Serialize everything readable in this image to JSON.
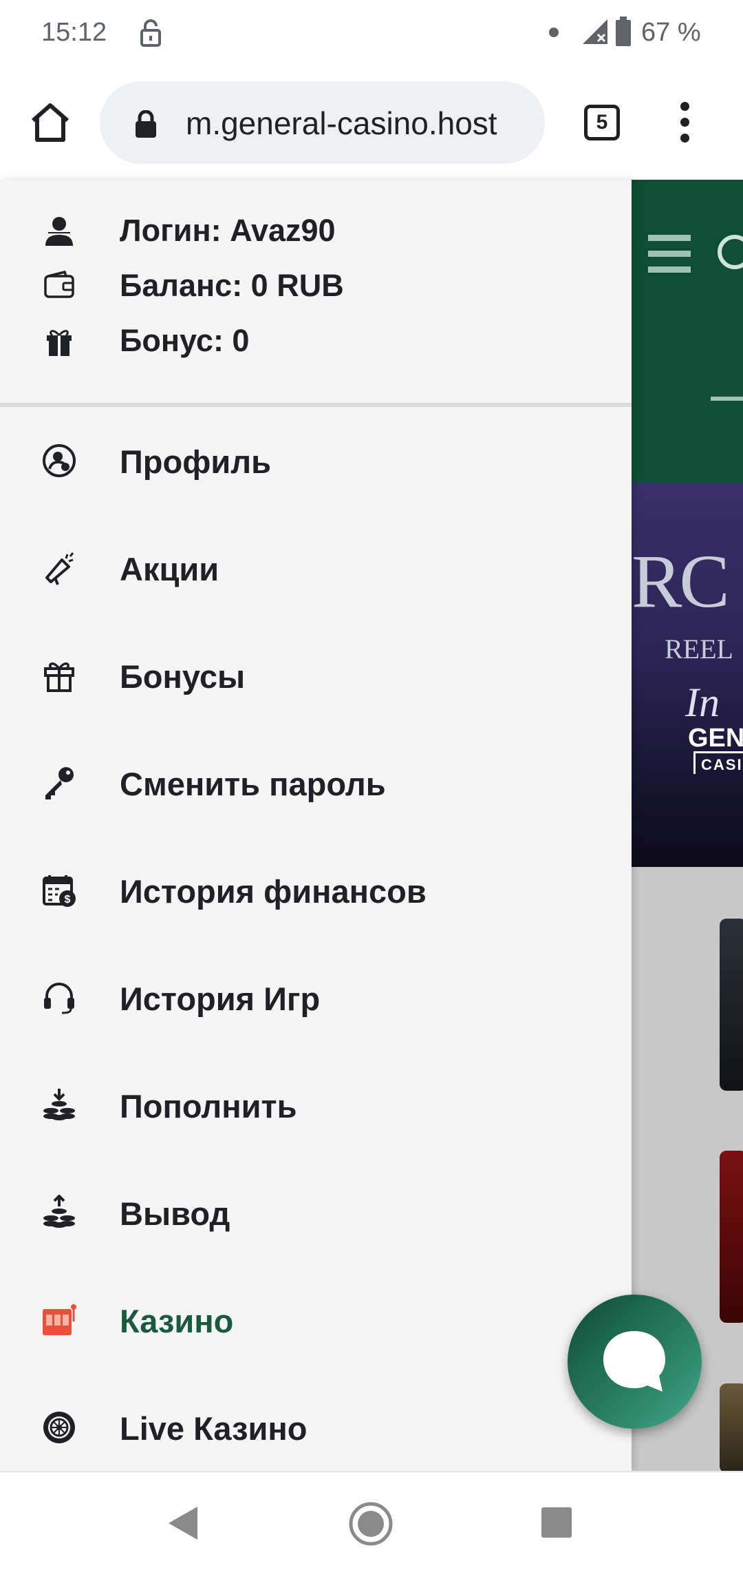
{
  "status_bar": {
    "time": "15:12",
    "battery": "67 %",
    "icons": [
      "lock-icon",
      "notification-dot",
      "signal-icon",
      "battery-icon"
    ]
  },
  "browser": {
    "url": "m.general-casino.host",
    "tab_count": "5"
  },
  "account": {
    "login": "Логин: Avaz90",
    "balance": "Баланс: 0 RUB",
    "bonus": "Бонус: 0"
  },
  "menu": {
    "items": [
      {
        "label": "Профиль",
        "icon": "profile-icon"
      },
      {
        "label": "Акции",
        "icon": "megaphone-icon"
      },
      {
        "label": "Бонусы",
        "icon": "gift-icon"
      },
      {
        "label": "Сменить пароль",
        "icon": "key-icon"
      },
      {
        "label": "История финансов",
        "icon": "calendar-dollar-icon"
      },
      {
        "label": "История Игр",
        "icon": "headset-icon"
      },
      {
        "label": "Пополнить",
        "icon": "coins-deposit-icon"
      },
      {
        "label": "Вывод",
        "icon": "coins-withdraw-icon"
      },
      {
        "label": "Казино",
        "icon": "slot-machine-icon",
        "active": true
      },
      {
        "label": "Live Казино",
        "icon": "roulette-icon"
      }
    ]
  },
  "banner": {
    "big_text": "RC",
    "reel_text": "REEL",
    "in_text": "In",
    "brand_line1": "GEN",
    "brand_line2": "CASIN"
  },
  "colors": {
    "accent": "#1a5a3f",
    "site_header": "#0e4e37",
    "drawer_bg": "#f5f5f5",
    "casino_icon": "#e8503a"
  }
}
